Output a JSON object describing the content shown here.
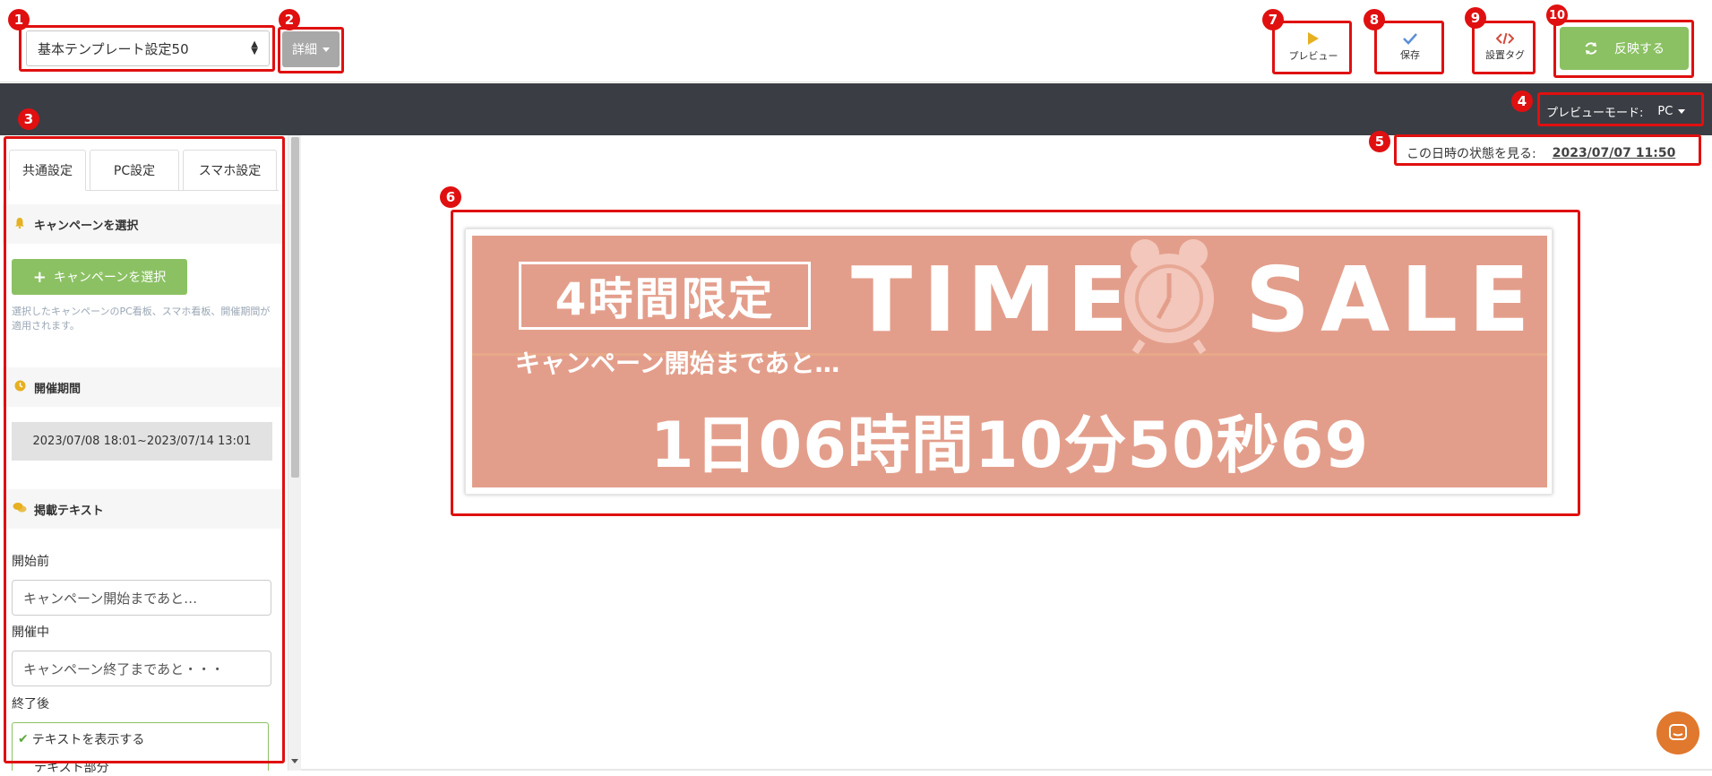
{
  "toolbar": {
    "template_select_value": "基本テンプレート設定50",
    "detail_label": "詳細",
    "preview_label": "プレビュー",
    "save_label": "保存",
    "tag_label": "設置タグ",
    "reflect_label": "反映する"
  },
  "preview_bar": {
    "mode_label": "プレビューモード:",
    "mode_value": "PC"
  },
  "panel": {
    "tabs": [
      {
        "label": "共通設定",
        "active": true
      },
      {
        "label": "PC設定",
        "active": false
      },
      {
        "label": "スマホ設定",
        "active": false
      }
    ],
    "campaign_section": {
      "title": "キャンペーンを選択",
      "button_label": "キャンペーンを選択",
      "help_text": "選択したキャンペーンのPC看板、スマホ看板、開催期間が適用されます。"
    },
    "period_section": {
      "title": "開催期間",
      "value": "2023/07/08 18:01~2023/07/14 13:01"
    },
    "text_section": {
      "title": "掲載テキスト",
      "before_label": "開始前",
      "before_value": "キャンペーン開始まであと…",
      "during_label": "開催中",
      "during_value": "キャンペーン終了まであと・・・",
      "after_label": "終了後",
      "after_check_label": "テキストを表示する",
      "after_partial": "テキスト部分"
    }
  },
  "preview": {
    "date_label": "この日時の状態を見る:",
    "date_value": "2023/07/07 11:50",
    "banner": {
      "limit_text": "4時間限定",
      "time_word": "TIME",
      "sale_word": "SALE",
      "countdown_label": "キャンペーン開始まであと…",
      "countdown_value": "1日06時間10分50秒69"
    }
  },
  "annotations": [
    "1",
    "2",
    "3",
    "4",
    "5",
    "6",
    "7",
    "8",
    "9",
    "10"
  ],
  "colors": {
    "annotation_red": "#e01010",
    "green_button": "#8bc163",
    "dark_bar": "#3a3d44",
    "banner_bg": "#e39e8b",
    "chat_orange": "#e0782d"
  }
}
